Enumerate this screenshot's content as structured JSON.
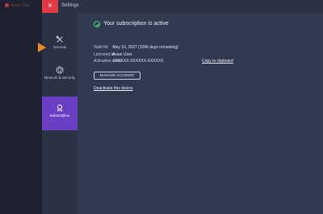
{
  "background": {
    "app_name": "Avast One",
    "faint_text": "..."
  },
  "titlebar": {
    "close_glyph": "×",
    "title": "Settings"
  },
  "sidebar": {
    "items": [
      {
        "label": "General",
        "icon": "tools-icon"
      },
      {
        "label": "Network & Security",
        "icon": "network-shield-icon"
      },
      {
        "label": "Subscription",
        "icon": "badge-icon",
        "active": true
      }
    ]
  },
  "subscription": {
    "status": "Your subscription is active",
    "valid_label": "Valid till:",
    "valid_value": "May 10, 2027 (1096 days remaining)",
    "licensed_label": "Licensed to:",
    "licensed_value": "Avast User",
    "code_label": "Activation code:",
    "code_value": "XXXXXX-XXXXXX-XXXXXX",
    "copy_link": "Copy to clipboard",
    "manage_button": "MANAGE ACCOUNT",
    "deactivate_link": "Deactivate this device"
  },
  "colors": {
    "accent_purple": "#6b3fc3",
    "close_red": "#e23b44",
    "arrow_orange": "#f08a1c",
    "success_green": "#4fd07c"
  }
}
